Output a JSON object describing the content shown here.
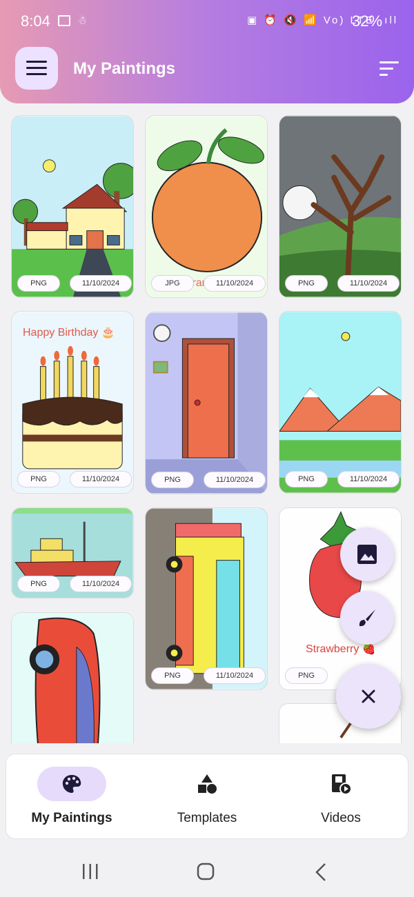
{
  "status_bar": {
    "time": "8:04",
    "icons": "▣ ⏰ 🔇 📶 Vo) LTE .ıll",
    "battery": "32%"
  },
  "app_bar": {
    "title": "My Paintings",
    "menu_icon": "hamburger-menu-icon",
    "sort_icon": "sort-icon"
  },
  "paintings": [
    {
      "format": "PNG",
      "date": "11/10/2024",
      "subject": "house"
    },
    {
      "format": "JPG",
      "date": "11/10/2024",
      "subject": "orange",
      "caption": "Orange"
    },
    {
      "format": "PNG",
      "date": "11/10/2024",
      "subject": "bare-tree-night"
    },
    {
      "format": "PNG",
      "date": "11/10/2024",
      "subject": "birthday-cake",
      "caption": "Happy Birthday 🎂"
    },
    {
      "format": "PNG",
      "date": "11/10/2024",
      "subject": "door-room"
    },
    {
      "format": "PNG",
      "date": "11/10/2024",
      "subject": "mountains"
    },
    {
      "format": "PNG",
      "date": "11/10/2024",
      "subject": "boat"
    },
    {
      "format": "PNG",
      "date": "11/10/2024",
      "subject": "truck"
    },
    {
      "format": "PNG",
      "date": "",
      "subject": "strawberry",
      "caption": "Strawberry 🍓"
    },
    {
      "format": "",
      "date": "",
      "subject": "car"
    },
    {
      "format": "",
      "date": "",
      "subject": "fruit"
    }
  ],
  "fab": {
    "image_icon": "image-icon",
    "brush_icon": "brush-icon",
    "close_icon": "close-icon"
  },
  "bottom_nav": {
    "items": [
      {
        "label": "My Paintings",
        "icon": "palette-icon",
        "active": true
      },
      {
        "label": "Templates",
        "icon": "shapes-icon",
        "active": false
      },
      {
        "label": "Videos",
        "icon": "video-icon",
        "active": false
      }
    ]
  },
  "colors": {
    "accent": "#9a63ec",
    "accent_light": "#ece2ff",
    "gradient_start": "#e69ab3"
  }
}
